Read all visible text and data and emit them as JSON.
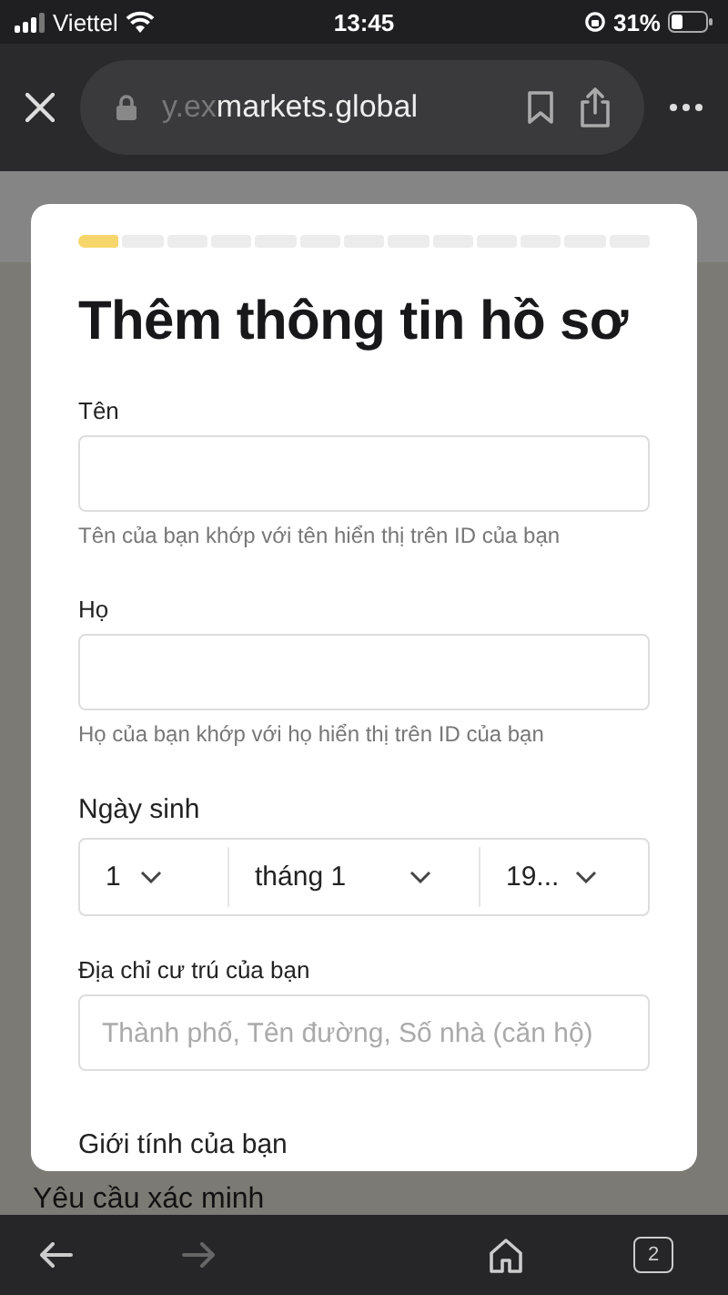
{
  "status_bar": {
    "carrier": "Viettel",
    "time": "13:45",
    "battery": "31%"
  },
  "browser": {
    "url_faded": "y.ex",
    "url": "markets.global"
  },
  "modal": {
    "progress": [
      {
        "done": true
      },
      {
        "done": false
      },
      {
        "done": false
      },
      {
        "done": false
      },
      {
        "done": false
      },
      {
        "done": false
      },
      {
        "done": false
      },
      {
        "done": false
      },
      {
        "done": false
      },
      {
        "done": false
      },
      {
        "done": false
      },
      {
        "done": false
      },
      {
        "done": false
      }
    ],
    "title": "Thêm thông tin hồ sơ",
    "first_name": {
      "label": "Tên",
      "hint": "Tên của bạn khớp với tên hiển thị trên ID của bạn"
    },
    "last_name": {
      "label": "Họ",
      "hint": "Họ của bạn khớp với họ hiển thị trên ID của bạn"
    },
    "birth_date": {
      "label": "Ngày sinh",
      "day": "1",
      "month": "tháng 1",
      "year": "19..."
    },
    "address": {
      "label": "Địa chỉ cư trú của bạn",
      "placeholder": "Thành phố, Tên đường, Số nhà (căn hộ)"
    },
    "gender_label": "Giới tính của bạn"
  },
  "page_heading": "Yêu cầu xác minh",
  "bottom_bar": {
    "forward_disabled": true,
    "tab_count": "2"
  }
}
